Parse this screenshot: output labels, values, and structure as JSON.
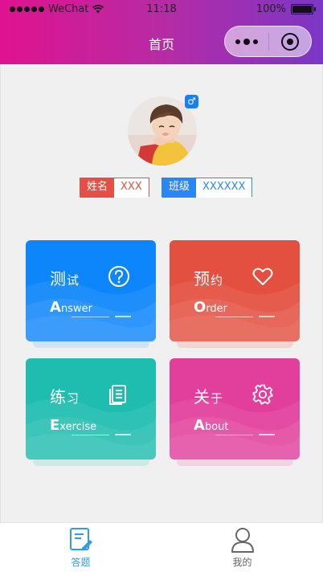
{
  "status_bar": {
    "carrier": "WeChat",
    "time": "11:18",
    "battery": "100%",
    "battery_level": 1.0
  },
  "nav": {
    "title": "首页"
  },
  "profile": {
    "gender_symbol": "♂",
    "name_label": "姓名",
    "name_value": "XXX",
    "class_label": "班级",
    "class_value": "XXXXXX"
  },
  "cards": {
    "answer": {
      "cn_main": "测",
      "cn_small": "试",
      "en_initial": "A",
      "en_rest": "nswer",
      "icon": "question-icon",
      "color": "#0d86fb"
    },
    "order": {
      "cn_main": "预",
      "cn_small": "约",
      "en_initial": "O",
      "en_rest": "rder",
      "icon": "heart-icon",
      "color": "#e4503f"
    },
    "exercise": {
      "cn_main": "练",
      "cn_small": "习",
      "en_initial": "E",
      "en_rest": "xercise",
      "icon": "document-icon",
      "color": "#1fbdb0"
    },
    "about": {
      "cn_main": "关",
      "cn_small": "于",
      "en_initial": "A",
      "en_rest": "bout",
      "icon": "gear-icon",
      "color": "#e23e9b"
    }
  },
  "tabbar": {
    "home_label": "答题",
    "mine_label": "我的",
    "active_color": "#2c9ee8",
    "inactive_color": "#666666"
  }
}
